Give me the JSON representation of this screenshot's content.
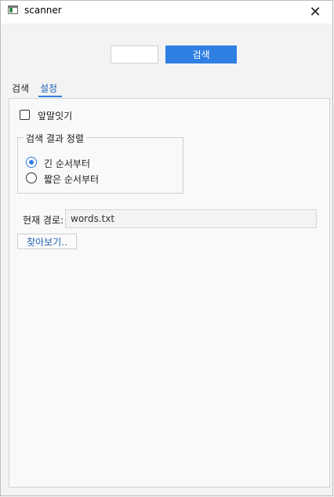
{
  "window": {
    "title": "scanner",
    "close_glyph": "✕"
  },
  "search": {
    "query": "",
    "button_label": "검색"
  },
  "tabs": [
    {
      "label": "검색",
      "active": false
    },
    {
      "label": "설정",
      "active": true
    }
  ],
  "settings": {
    "autocomplete_label": "앞말잇기",
    "autocomplete_checked": false,
    "sort_group_title": "검색 결과 정렬",
    "sort_options": [
      {
        "label": "긴 순서부터",
        "selected": true
      },
      {
        "label": "짧은 순서부터",
        "selected": false
      }
    ],
    "path_label": "현재 경로:",
    "path_value": "words.txt",
    "browse_label": "찾아보기.."
  },
  "colors": {
    "accent": "#2f7fe3",
    "link": "#1a5fb4"
  }
}
